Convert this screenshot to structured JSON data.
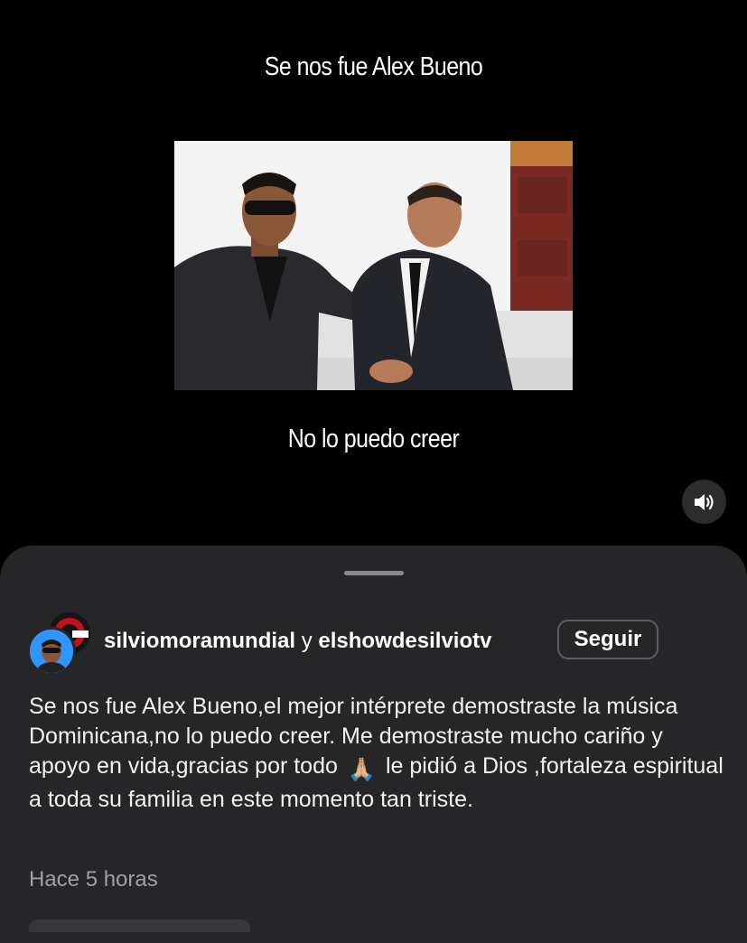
{
  "reel": {
    "caption_top": "Se nos fue Alex Bueno",
    "caption_bottom": "No lo puedo creer",
    "volume_icon": "speaker-on-icon"
  },
  "post": {
    "author_1": "silviomoramundial",
    "conjunction": "y",
    "author_2": "elshowdesilviotv",
    "follow_label": "Seguir",
    "text_before_emoji": "Se nos fue Alex Bueno,el mejor intérprete demostraste la música Dominicana,no lo puedo creer. Me demostraste mucho cariño y apoyo en vida,gracias por todo",
    "emoji": "🙏🏼",
    "text_after_emoji": "le pidió a Dios ,fortaleza espiritual a toda su familia en este momento tan triste.",
    "timestamp": "Hace 5 horas"
  },
  "colors": {
    "sheet_bg": "#262628",
    "muted_text": "#a0a0a5",
    "follow_border": "#5e5e62"
  }
}
